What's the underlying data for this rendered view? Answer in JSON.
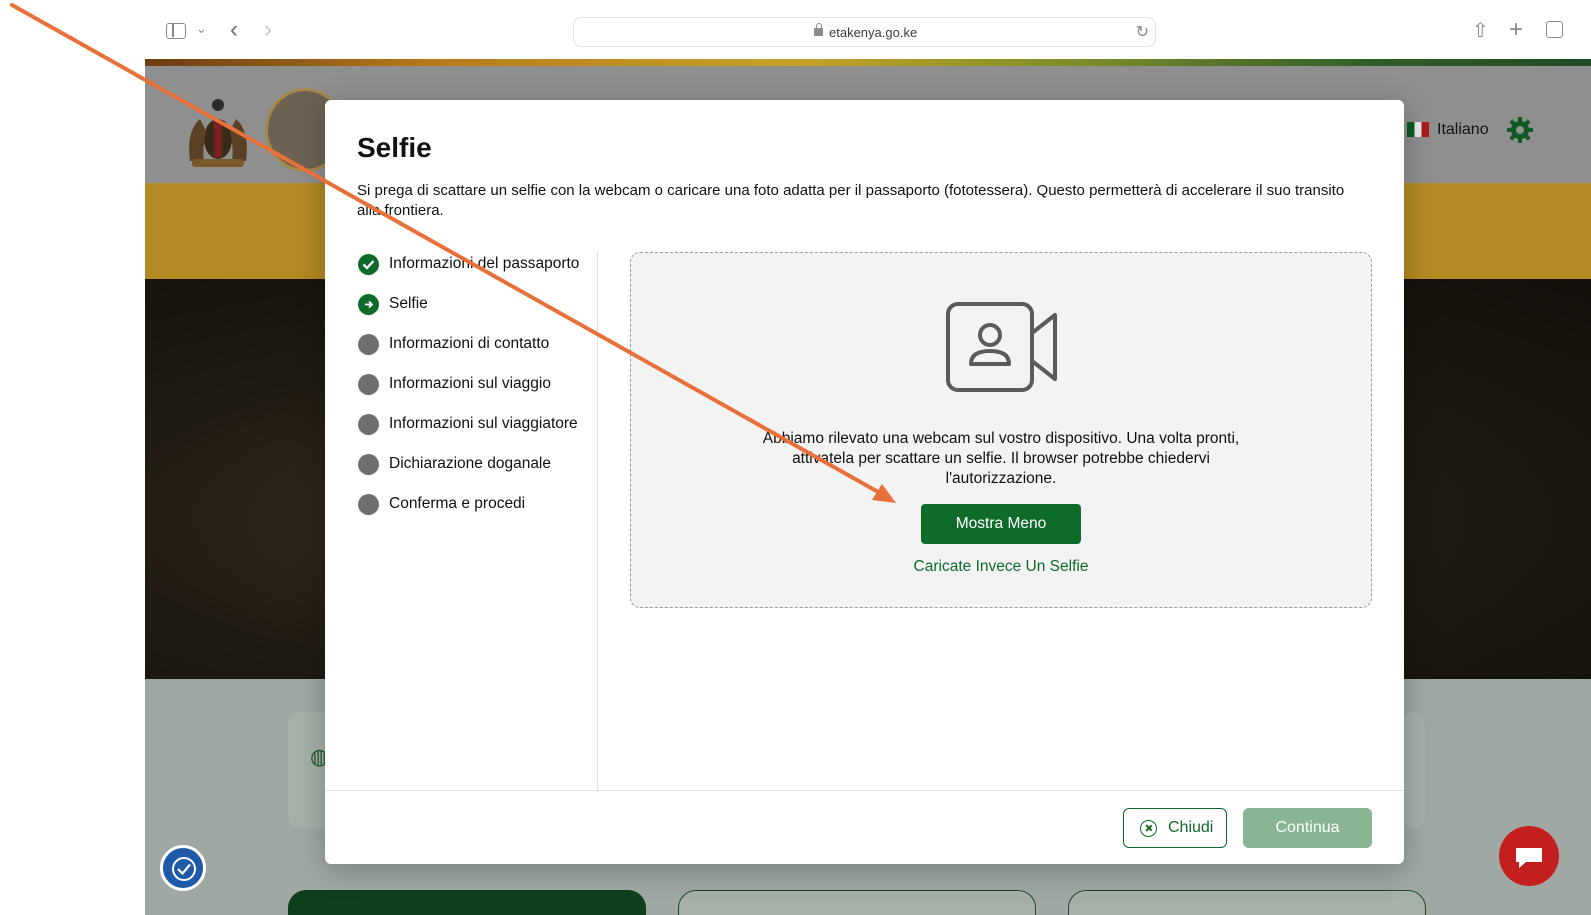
{
  "browser": {
    "url": "etakenya.go.ke",
    "icons": [
      "sidebar-icon",
      "chevron-down-icon",
      "back-icon",
      "forward-icon",
      "lock-icon",
      "reload-icon",
      "share-icon",
      "plus-icon",
      "tabs-icon"
    ]
  },
  "header": {
    "language": "Italiano"
  },
  "modal": {
    "title": "Selfie",
    "description": "Si prega di scattare un selfie con la webcam o caricare una foto adatta per il passaporto (fototessera). Questo permetterà di accelerare il suo transito alla frontiera.",
    "steps": [
      {
        "label": "Informazioni del passaporto",
        "status": "done"
      },
      {
        "label": "Selfie",
        "status": "current"
      },
      {
        "label": "Informazioni di contatto",
        "status": "pending"
      },
      {
        "label": "Informazioni sul viaggio",
        "status": "pending"
      },
      {
        "label": "Informazioni sul viaggiatore",
        "status": "pending"
      },
      {
        "label": "Dichiarazione doganale",
        "status": "pending"
      },
      {
        "label": "Conferma e procedi",
        "status": "pending"
      }
    ],
    "webcam_message": "Abbiamo rilevato una webcam sul vostro dispositivo. Una volta pronti, attivatela per scattare un selfie. Il browser potrebbe chiedervi l'autorizzazione.",
    "show_less_label": "Mostra Meno",
    "upload_label": "Caricate Invece Un Selfie",
    "close_label": "Chiudi",
    "continue_label": "Continua"
  },
  "colors": {
    "primary_green": "#0f6b2a",
    "continue_disabled": "#88b592",
    "annotation_arrow": "#e8703a"
  }
}
